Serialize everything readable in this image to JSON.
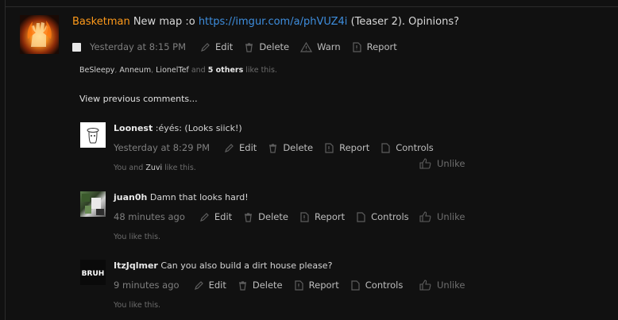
{
  "main_post": {
    "author": "Basketman",
    "text_before": "New map :o",
    "link": "https://imgur.com/a/phVUZ4i",
    "text_after": "(Teaser 2). Opinions?",
    "timestamp": "Yesterday at 8:15 PM",
    "actions": {
      "edit": "Edit",
      "delete": "Delete",
      "warn": "Warn",
      "report": "Report"
    },
    "likes": {
      "names": [
        "BeSleepy",
        "Anneum",
        "LionelTef"
      ],
      "and": "and",
      "others": "5 others",
      "suffix": "like this."
    }
  },
  "view_previous": "View previous comments...",
  "comments": [
    {
      "author": "Loonest",
      "text": ":éyés: (Looks siick!)",
      "timestamp": "Yesterday at 8:29 PM",
      "likes_prefix": "You and",
      "likes_name": "Zuvi",
      "likes_suffix": "like this."
    },
    {
      "author": "juan0h",
      "text": "Damn that looks hard!",
      "timestamp": "48 minutes ago",
      "likes_prefix": "You like this."
    },
    {
      "author": "ItzJqlmer",
      "text": "Can you also build a dirt house please?",
      "timestamp": "9 minutes ago",
      "likes_prefix": "You like this.",
      "avatar_text": "BRUH"
    }
  ],
  "comment_actions": {
    "edit": "Edit",
    "delete": "Delete",
    "report": "Report",
    "controls": "Controls",
    "unlike": "Unlike"
  },
  "colors": {
    "background": "#111111",
    "username": "#ff9a1a",
    "link": "#3e8ede",
    "muted": "#7f7f7f"
  }
}
